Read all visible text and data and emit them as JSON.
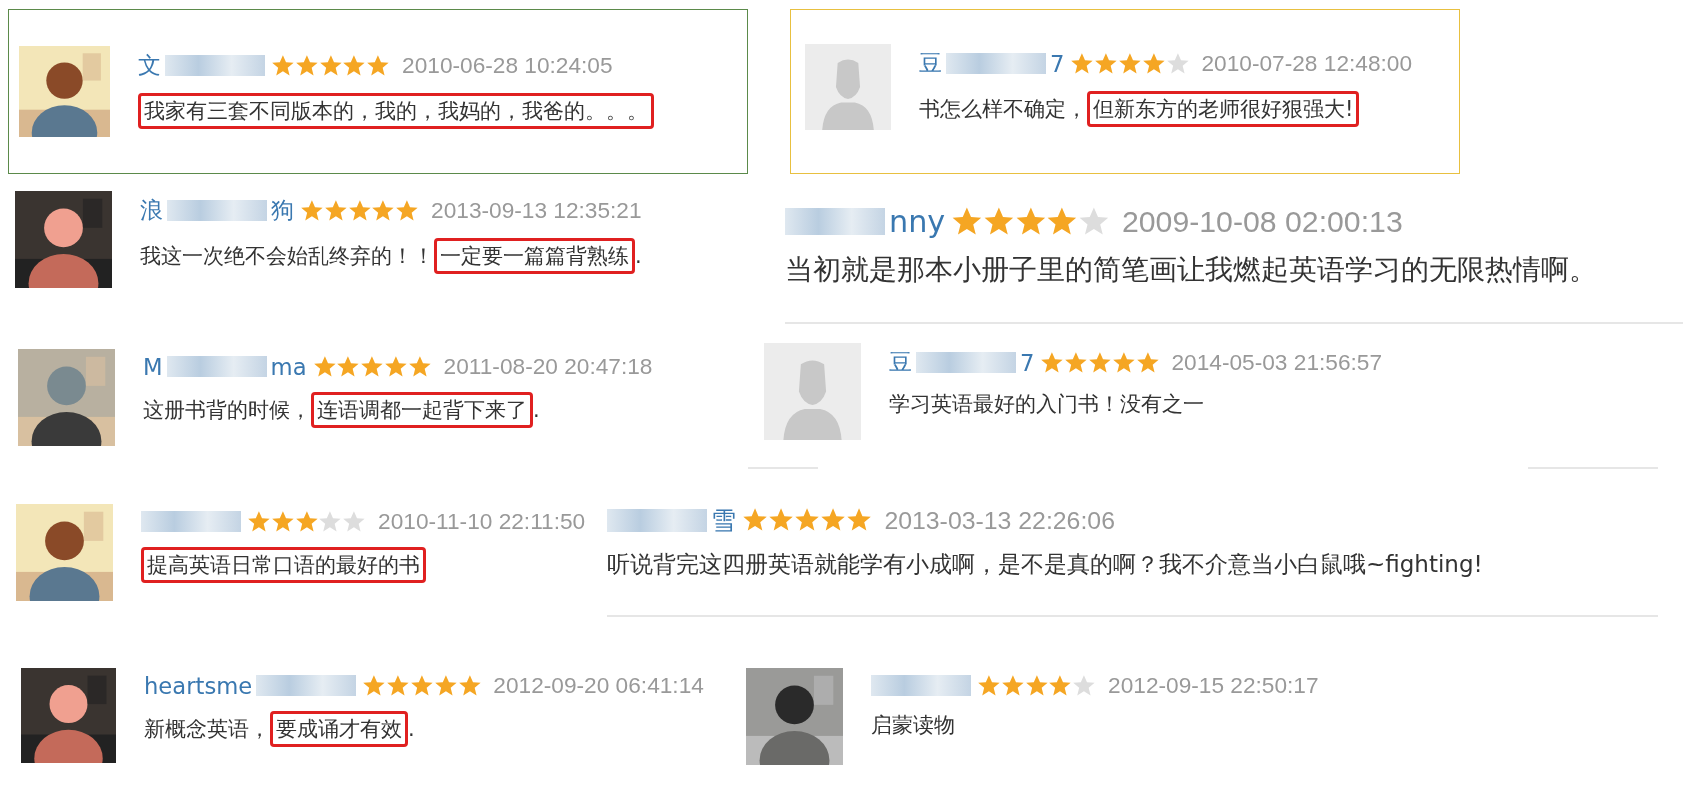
{
  "reviews": [
    {
      "color": "#5b8a4a",
      "avatar": {
        "kind": "picture"
      },
      "name_start": "文",
      "stars": 5,
      "date": "2010-06-28 10:24:05",
      "text": [
        {
          "t": "我家有三套不同版本的，我的，我妈的，我爸的。。。",
          "highlight": true
        }
      ]
    },
    {
      "color": "#e8c040",
      "avatar": {
        "kind": "default"
      },
      "name_start": "豆",
      "name_end": "7",
      "stars": 4,
      "date": "2010-07-28 12:48:00",
      "text": [
        {
          "t": "书怎么样不确定，",
          "highlight": false
        },
        {
          "t": "但新东方的老师很好狠强大!",
          "highlight": true
        }
      ]
    },
    {
      "avatar": {
        "kind": "picture"
      },
      "name_start": "浪",
      "name_end": "狗",
      "stars": 5,
      "date": "2013-09-13 12:35:21",
      "text": [
        {
          "t": "我这一次绝不会始乱终弃的！！",
          "highlight": false
        },
        {
          "t": "一定要一篇篇背熟练",
          "highlight": true
        },
        {
          "t": ".",
          "highlight": false
        }
      ]
    },
    {
      "name_end": "nny",
      "stars": 4,
      "date": "2009-10-08 02:00:13",
      "text": [
        {
          "t": "当初就是那本小册子里的简笔画让我燃起英语学习的无限热情啊。",
          "highlight": false
        }
      ]
    },
    {
      "avatar": {
        "kind": "picture"
      },
      "name_start": "M",
      "name_end": "ma",
      "stars": 5,
      "date": "2011-08-20 20:47:18",
      "text": [
        {
          "t": "这册书背的时候，",
          "highlight": false
        },
        {
          "t": "连语调都一起背下来了",
          "highlight": true
        },
        {
          "t": ".",
          "highlight": false
        }
      ]
    },
    {
      "avatar": {
        "kind": "default"
      },
      "name_start": "豆",
      "name_end": "7",
      "stars": 5,
      "date": "2014-05-03 21:56:57",
      "text": [
        {
          "t": "学习英语最好的入门书！没有之一",
          "highlight": false
        }
      ]
    },
    {
      "avatar": {
        "kind": "picture"
      },
      "stars": 3,
      "date": "2010-11-10 22:11:50",
      "text": [
        {
          "t": "提高英语日常口语的最好的书",
          "highlight": true
        }
      ]
    },
    {
      "name_end": "雪",
      "stars": 5,
      "date": "2013-03-13 22:26:06",
      "text": [
        {
          "t": "听说背完这四册英语就能学有小成啊，是不是真的啊？我不介意当小白鼠哦~fighting!",
          "highlight": false
        }
      ]
    },
    {
      "avatar": {
        "kind": "picture"
      },
      "name_start": "heartsme",
      "stars": 5,
      "date": "2012-09-20 06:41:14",
      "text": [
        {
          "t": "新概念英语，",
          "highlight": false
        },
        {
          "t": "要成诵才有效",
          "highlight": true
        },
        {
          "t": ".",
          "highlight": false
        }
      ]
    },
    {
      "avatar": {
        "kind": "picture"
      },
      "stars": 4,
      "date": "2012-09-15 22:50:17",
      "text": [
        {
          "t": "启蒙读物",
          "highlight": false
        }
      ]
    }
  ]
}
